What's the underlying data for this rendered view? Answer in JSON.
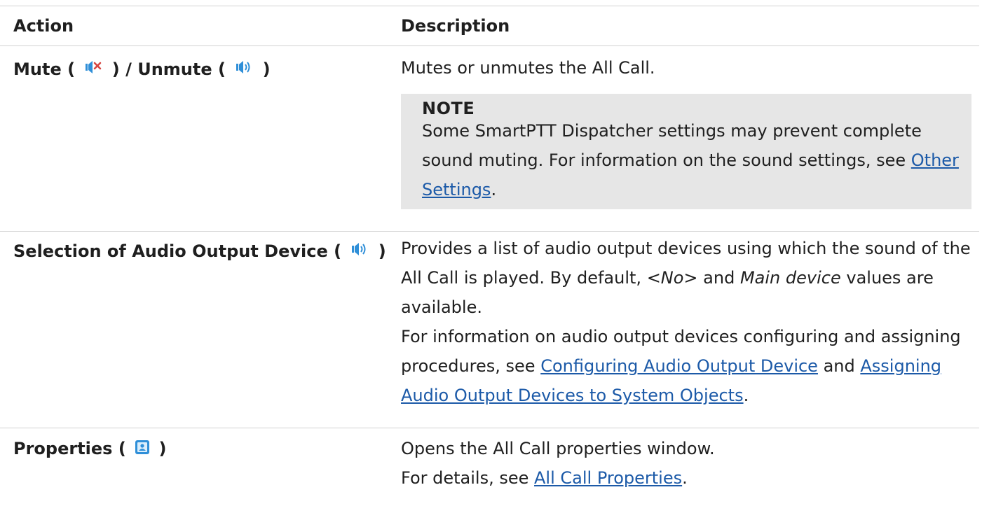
{
  "table": {
    "headers": {
      "action": "Action",
      "description": "Description"
    },
    "rows": [
      {
        "mute_label": "Mute (",
        "mute_close": ") / Unmute (",
        "unmute_close": ")",
        "mute_icon": "speaker-muted-icon",
        "unmute_icon": "speaker-icon",
        "description": "Mutes or unmutes the All Call.",
        "note": {
          "title": "NOTE",
          "text_1": "Some SmartPTT Dispatcher settings may prevent complete sound muting. For information on the sound settings, see ",
          "link": "Other Settings",
          "text_2": "."
        }
      },
      {
        "action_label": "Selection of Audio Output Device (",
        "action_close": ")",
        "icon": "speaker-icon",
        "desc_1": "Provides a list of audio output devices using which the sound of the All Call is played. By default, ",
        "desc_no": "<No>",
        "desc_2": " and ",
        "desc_main": "Main device",
        "desc_3": " values are available.",
        "desc_4": "For information on audio output devices configuring and assigning procedures, see ",
        "link_1": "Configuring Audio Output Device",
        "desc_5": " and ",
        "link_2": "Assigning Audio Output Devices to System Objects",
        "desc_6": "."
      },
      {
        "action_label": "Properties (",
        "action_close": ")",
        "icon": "properties-icon",
        "desc_1": "Opens the All Call properties window.",
        "desc_2": "For details, see ",
        "link": "All Call Properties",
        "desc_3": "."
      }
    ]
  },
  "colors": {
    "link": "#1c5aa8",
    "note_bg": "#e6e6e6",
    "muted_x": "#d64541",
    "speaker": "#2f8fd8"
  }
}
